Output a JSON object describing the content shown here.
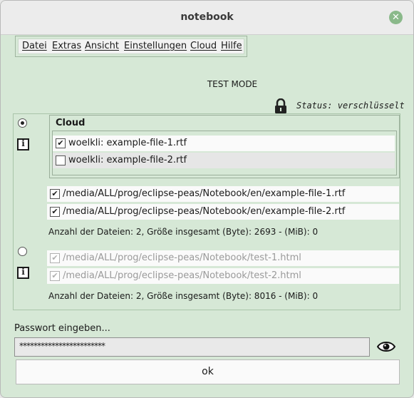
{
  "window": {
    "title": "notebook"
  },
  "menu": {
    "items": [
      "Datei",
      "Extras",
      "Ansicht",
      "Einstellungen",
      "Cloud",
      "Hilfe"
    ]
  },
  "mode_label": "TEST MODE",
  "status": {
    "text": "Status: verschlüsselt",
    "icon": "lock-icon"
  },
  "cloud": {
    "title": "Cloud",
    "selected": true,
    "files": [
      {
        "checked": true,
        "label": "woelkli: example-file-1.rtf"
      },
      {
        "checked": false,
        "label": "woelkli: example-file-2.rtf"
      }
    ]
  },
  "local_en": {
    "files": [
      {
        "checked": true,
        "label": "/media/ALL/prog/eclipse-peas/Notebook/en/example-file-1.rtf"
      },
      {
        "checked": true,
        "label": "/media/ALL/prog/eclipse-peas/Notebook/en/example-file-2.rtf"
      }
    ],
    "summary": "Anzahl der Dateien: 2, Größe insgesamt (Byte): 2693 - (MiB): 0"
  },
  "local_test": {
    "selected": false,
    "files": [
      {
        "checked": true,
        "disabled": true,
        "label": "/media/ALL/prog/eclipse-peas/Notebook/test-1.html"
      },
      {
        "checked": true,
        "disabled": true,
        "label": "/media/ALL/prog/eclipse-peas/Notebook/test-2.html"
      }
    ],
    "summary": "Anzahl der Dateien: 2, Größe insgesamt (Byte): 8016 - (MiB): 0"
  },
  "password": {
    "label": "Passwort eingeben...",
    "masked_value": "************************"
  },
  "ok_label": "ok"
}
